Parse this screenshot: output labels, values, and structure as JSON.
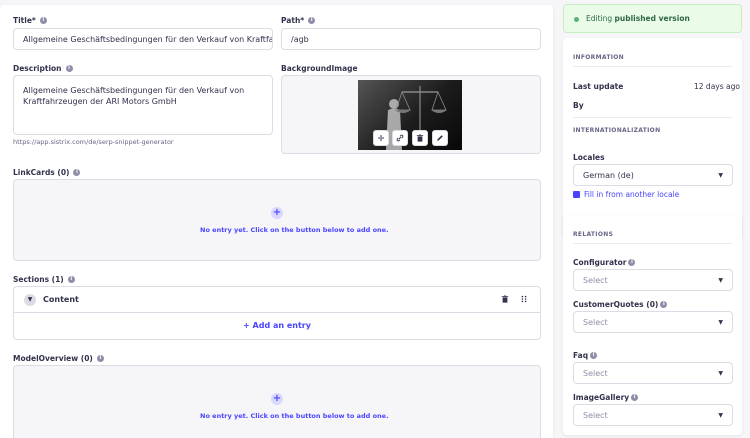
{
  "form": {
    "title": {
      "label": "Title*",
      "value": "Allgemeine Geschäftsbedingungen für den Verkauf von Kraftfahrzeugen"
    },
    "path": {
      "label": "Path*",
      "value": "/agb"
    },
    "description": {
      "label": "Description",
      "value": "Allgemeine Geschäftsbedingungen für den Verkauf von Kraftfahrzeugen der ARI Motors GmbH",
      "hint": "https://app.sistrix.com/de/serp-snippet-generator"
    },
    "background_image": {
      "label": "BackgroundImage"
    },
    "link_cards": {
      "label": "LinkCards (0)",
      "empty_text": "No entry yet. Click on the button below to add one."
    },
    "sections": {
      "label": "Sections (1)",
      "items": [
        {
          "title": "Content"
        }
      ],
      "add_label": "Add an entry"
    },
    "model_overview": {
      "label": "ModelOverview (0)",
      "empty_text": "No entry yet. Click on the button below to add one."
    }
  },
  "sidebar": {
    "status_prefix": "Editing ",
    "status_strong": "published version",
    "information": {
      "heading": "INFORMATION",
      "last_update_label": "Last update",
      "last_update_value": "12 days ago",
      "by_label": "By"
    },
    "internationalization": {
      "heading": "INTERNATIONALIZATION",
      "locales_label": "Locales",
      "locale_value": "German (de)",
      "fill_link": "Fill in from another locale"
    },
    "relations": {
      "heading": "RELATIONS",
      "fields": [
        {
          "label": "Configurator",
          "placeholder": "Select"
        },
        {
          "label": "CustomerQuotes (0)",
          "placeholder": "Select"
        },
        {
          "label": "Faq",
          "placeholder": "Select"
        },
        {
          "label": "ImageGallery",
          "placeholder": "Select"
        }
      ]
    }
  },
  "colors": {
    "accent": "#4945ff",
    "success_bg": "#eafbe7",
    "text": "#32324d"
  },
  "icons": [
    "info-icon",
    "plus-icon",
    "move-icon",
    "link-icon",
    "trash-icon",
    "edit-icon",
    "chevron-down-icon",
    "drag-icon",
    "locale-copy-icon"
  ]
}
